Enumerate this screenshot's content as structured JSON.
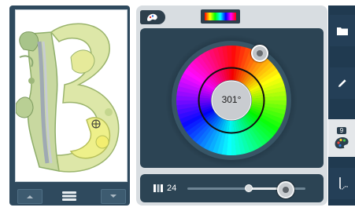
{
  "color_picker": {
    "hue_label": "301°",
    "hue_value": 301
  },
  "slider": {
    "value_label": "24",
    "fraction": 0.78
  },
  "palette_button": {
    "badge": "9"
  },
  "colors": {
    "panel_dark": "#2c4454",
    "sidebar": "#203a50",
    "accent_knob": "#c0c4c8"
  }
}
